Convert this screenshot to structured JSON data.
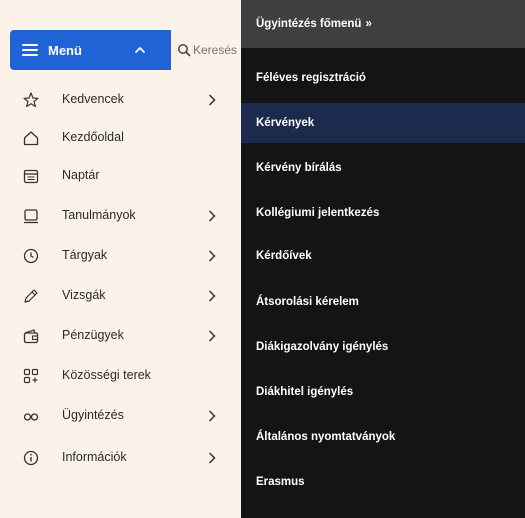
{
  "menu": {
    "label": "Menü",
    "search_placeholder": "Keresés"
  },
  "sidebar": {
    "items": [
      {
        "label": "Kedvencek",
        "icon": "star-icon",
        "has_arrow": true
      },
      {
        "label": "Kezdőoldal",
        "icon": "home-icon",
        "has_arrow": false
      },
      {
        "label": "Naptár",
        "icon": "calendar-icon",
        "has_arrow": false
      },
      {
        "label": "Tanulmányok",
        "icon": "monitor-icon",
        "has_arrow": true
      },
      {
        "label": "Tárgyak",
        "icon": "clock-icon",
        "has_arrow": true
      },
      {
        "label": "Vizsgák",
        "icon": "pencil-icon",
        "has_arrow": true
      },
      {
        "label": "Pénzügyek",
        "icon": "wallet-icon",
        "has_arrow": true
      },
      {
        "label": "Közösségi terek",
        "icon": "grid-plus-icon",
        "has_arrow": false
      },
      {
        "label": "Ügyintézés",
        "icon": "infinity-icon",
        "has_arrow": true
      },
      {
        "label": "Információk",
        "icon": "info-icon",
        "has_arrow": true
      }
    ]
  },
  "submenu": {
    "title": "Ügyintézés főmenü",
    "caret": "»",
    "items": [
      {
        "label": "Féléves regisztráció",
        "active": false
      },
      {
        "label": "Kérvények",
        "active": true
      },
      {
        "label": "Kérvény bírálás",
        "active": false
      },
      {
        "label": "Kollégiumi jelentkezés",
        "active": false
      },
      {
        "label": "Kérdőívek",
        "active": false
      },
      {
        "label": "Átsorolási kérelem",
        "active": false
      },
      {
        "label": "Diákigazolvány igénylés",
        "active": false
      },
      {
        "label": "Diákhitel igénylés",
        "active": false
      },
      {
        "label": "Általános nyomtatványok",
        "active": false
      },
      {
        "label": "Erasmus",
        "active": false
      }
    ]
  },
  "colors": {
    "accent": "#1f63d6",
    "submenu_bg": "#141414",
    "submenu_header": "#404040",
    "active_item": "#1a2b4d",
    "page_bg": "#fbf3e9"
  }
}
